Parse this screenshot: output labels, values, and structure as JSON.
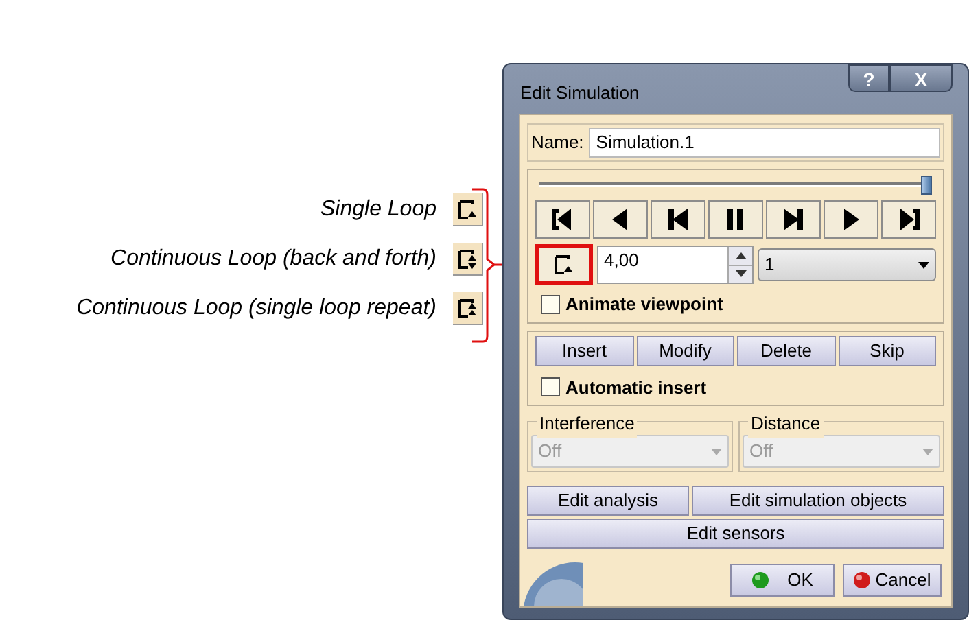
{
  "annotations": [
    {
      "label": "Single Loop",
      "kind": "single"
    },
    {
      "label": "Continuous Loop (back and forth)",
      "kind": "back_forth"
    },
    {
      "label": "Continuous Loop (single loop repeat)",
      "kind": "repeat"
    }
  ],
  "dialog": {
    "title": "Edit Simulation",
    "title_buttons": [
      {
        "label": "?",
        "kind": "help"
      },
      {
        "label": "X",
        "kind": "close"
      }
    ],
    "name_label": "Name:",
    "name_value": "Simulation.1",
    "slider": {
      "level": 1
    },
    "player_buttons": [
      {
        "kind": "jump_start"
      },
      {
        "kind": "play_back"
      },
      {
        "kind": "step_back"
      },
      {
        "kind": "pause"
      },
      {
        "kind": "step_forward"
      },
      {
        "kind": "play"
      },
      {
        "kind": "jump_end"
      }
    ],
    "loop_mode": {
      "kind": "single",
      "highlighted": true
    },
    "step_value": "4,00",
    "step_select": "1",
    "animate_viewpoint": {
      "label": "Animate viewpoint",
      "checked": false
    },
    "record_buttons": [
      "Insert",
      "Modify",
      "Delete",
      "Skip"
    ],
    "automatic_insert": {
      "label": "Automatic insert",
      "checked": false
    },
    "groups": [
      {
        "label": "Interference",
        "value": "Off",
        "disabled": true
      },
      {
        "label": "Distance",
        "value": "Off",
        "disabled": true
      }
    ],
    "edit_buttons": [
      "Edit analysis",
      "Edit simulation objects",
      "Edit sensors"
    ],
    "ok": "OK",
    "cancel": "Cancel"
  }
}
